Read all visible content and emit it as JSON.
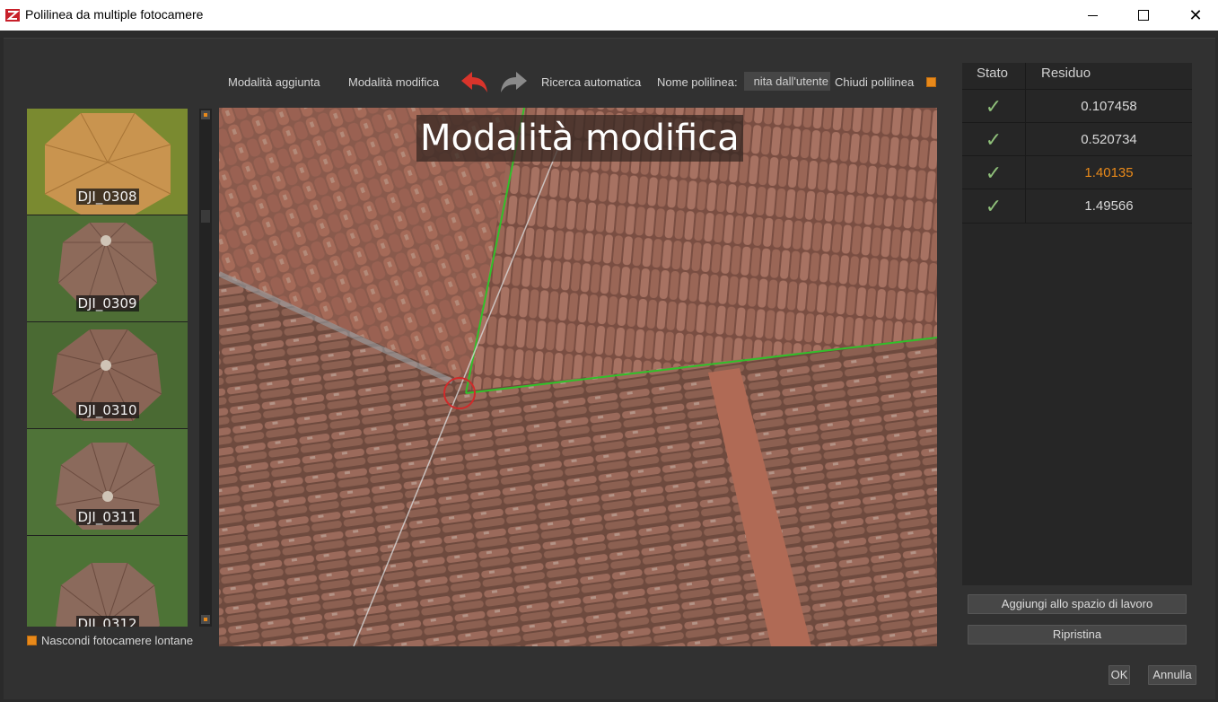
{
  "window": {
    "title": "Polilinea da multiple fotocamere",
    "min_label": "",
    "max_label": "",
    "close_label": "✕"
  },
  "toolbar": {
    "add_mode": "Modalità aggiunta",
    "edit_mode": "Modalità modifica",
    "auto_search": "Ricerca automatica",
    "polyline_name_label": "Nome polilinea:",
    "polyline_name_value": "nita dall'utente",
    "close_polyline": "Chiudi polilinea",
    "undo_color": "#d9342b",
    "redo_color": "#8a8a8a"
  },
  "thumbnails": [
    {
      "label": "DJI_0308"
    },
    {
      "label": "DJI_0309"
    },
    {
      "label": "DJI_0310"
    },
    {
      "label": "DJI_0311"
    },
    {
      "label": "DJI_0312"
    }
  ],
  "hide_far_cameras": "Nascondi fotocamere lontane",
  "viewport": {
    "mode_title": "Modalità modifica"
  },
  "table": {
    "headers": {
      "status": "Stato",
      "residual": "Residuo"
    },
    "rows": [
      {
        "status": "✓",
        "residual": "0.107458",
        "highlight": false
      },
      {
        "status": "✓",
        "residual": "0.520734",
        "highlight": false
      },
      {
        "status": "✓",
        "residual": "1.40135",
        "highlight": true
      },
      {
        "status": "✓",
        "residual": "1.49566",
        "highlight": false
      }
    ],
    "highlight_color": "#e8891a"
  },
  "buttons": {
    "add_to_workspace": "Aggiungi allo spazio di lavoro",
    "reset": "Ripristina",
    "ok": "OK",
    "cancel": "Annulla"
  },
  "accent_color": "#e8891a"
}
